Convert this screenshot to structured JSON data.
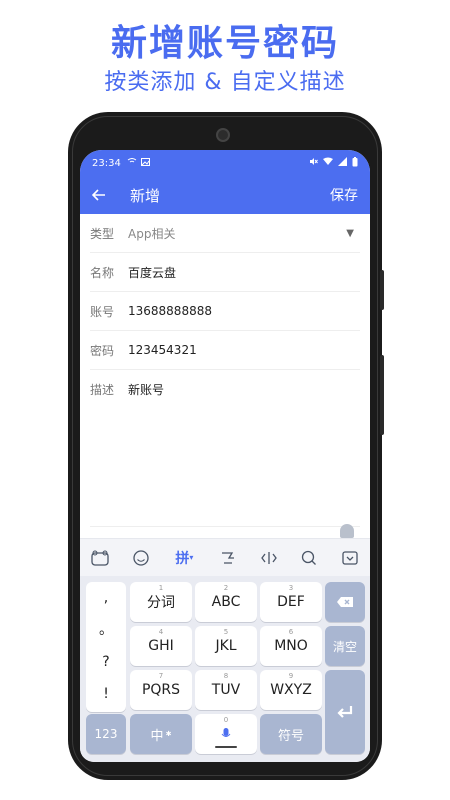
{
  "promo": {
    "title": "新增账号密码",
    "subtitle": "按类添加 & 自定义描述"
  },
  "status_bar": {
    "time": "23:34"
  },
  "app_bar": {
    "title": "新增",
    "save_label": "保存",
    "back_icon": "arrow-left-icon"
  },
  "form": {
    "type_label": "类型",
    "type_value": "App相关",
    "name_label": "名称",
    "name_value": "百度云盘",
    "account_label": "账号",
    "account_value": "13688888888",
    "password_label": "密码",
    "password_value": "123454321",
    "desc_label": "描述",
    "desc_value": "新账号"
  },
  "keyboard": {
    "toolbar_pinyin": "拼",
    "punct": [
      ",",
      "。",
      "?",
      "!"
    ],
    "row1": [
      {
        "num": "1",
        "label": "分词"
      },
      {
        "num": "2",
        "label": "ABC"
      },
      {
        "num": "3",
        "label": "DEF"
      }
    ],
    "row2": [
      {
        "num": "4",
        "label": "GHI"
      },
      {
        "num": "5",
        "label": "JKL"
      },
      {
        "num": "6",
        "label": "MNO"
      }
    ],
    "row3": [
      {
        "num": "7",
        "label": "PQRS"
      },
      {
        "num": "8",
        "label": "TUV"
      },
      {
        "num": "9",
        "label": "WXYZ"
      }
    ],
    "clear_label": "清空",
    "num_label": "123",
    "zh_label": "中",
    "space_num": "0",
    "symbol_label": "符号"
  },
  "colors": {
    "accent": "#4c6ef0",
    "promo_text": "#4a6cf0",
    "key_gray": "#a9b6d1"
  }
}
